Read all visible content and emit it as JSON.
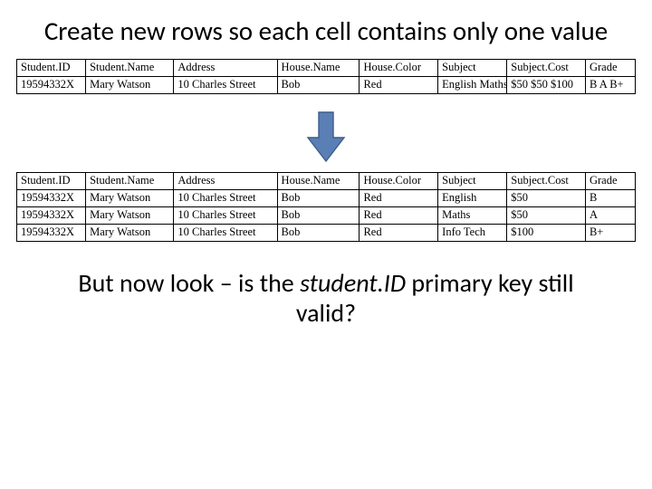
{
  "title": "Create new rows so each cell contains only one value",
  "caption_pre": "But now look – is the ",
  "caption_ital": "student.ID",
  "caption_post": " primary key still valid?",
  "columns": [
    "Student.ID",
    "Student.Name",
    "Address",
    "House.Name",
    "House.Color",
    "Subject",
    "Subject.Cost",
    "Grade"
  ],
  "table1_rows": [
    {
      "id": "19594332X",
      "name": "Mary Watson",
      "addr": "10 Charles Street",
      "hname": "Bob",
      "hcol": "Red",
      "subj": "English\nMaths\nInfo Tech",
      "cost": "$50\n$50\n$100",
      "grade": "B\nA\nB+"
    }
  ],
  "table2_rows": [
    {
      "id": "19594332X",
      "name": "Mary Watson",
      "addr": "10 Charles Street",
      "hname": "Bob",
      "hcol": "Red",
      "subj": "English",
      "cost": "$50",
      "grade": "B"
    },
    {
      "id": "19594332X",
      "name": "Mary Watson",
      "addr": "10 Charles Street",
      "hname": "Bob",
      "hcol": "Red",
      "subj": "Maths",
      "cost": "$50",
      "grade": "A"
    },
    {
      "id": "19594332X",
      "name": "Mary Watson",
      "addr": "10 Charles Street",
      "hname": "Bob",
      "hcol": "Red",
      "subj": "Info Tech",
      "cost": "$100",
      "grade": "B+"
    }
  ],
  "arrow_color_fill": "#5a7fb5",
  "arrow_color_stroke": "#3d5d8a"
}
